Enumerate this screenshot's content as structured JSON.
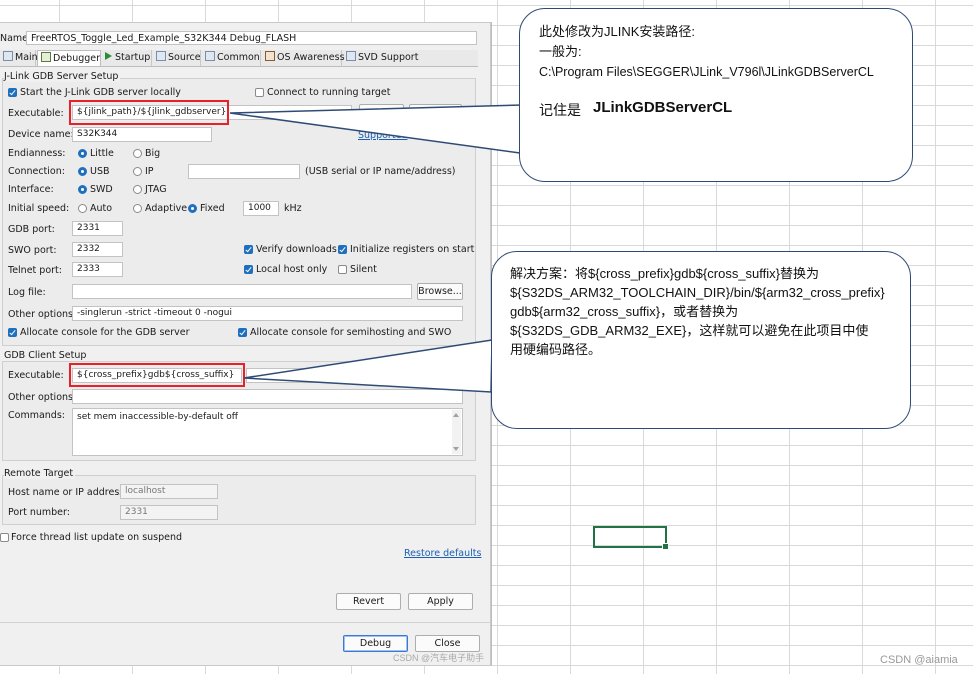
{
  "dialog": {
    "name_label": "Name:",
    "name_value": "FreeRTOS_Toggle_Led_Example_S32K344 Debug_FLASH",
    "tabs": [
      {
        "label": "Main",
        "icon": "main-icon"
      },
      {
        "label": "Debugger",
        "icon": "debugger-icon"
      },
      {
        "label": "Startup",
        "icon": "startup-icon"
      },
      {
        "label": "Source",
        "icon": "source-icon"
      },
      {
        "label": "Common",
        "icon": "common-icon"
      },
      {
        "label": "OS Awareness",
        "icon": "os-awareness-icon"
      },
      {
        "label": "SVD Support",
        "icon": "svd-support-icon"
      }
    ],
    "server": {
      "group_title": "J-Link GDB Server Setup",
      "start_locally_label": "Start the J-Link GDB server locally",
      "connect_running_label": "Connect to running target",
      "executable_label": "Executable:",
      "executable_value": "${jlink_path}/${jlink_gdbserver}",
      "device_name_label": "Device name:",
      "device_name_value": "S32K344",
      "supported_link": "Supported",
      "endianness_label": "Endianness:",
      "endianness_little": "Little",
      "endianness_big": "Big",
      "connection_label": "Connection:",
      "connection_usb": "USB",
      "connection_ip": "IP",
      "connection_hint": "(USB serial or IP name/address)",
      "interface_label": "Interface:",
      "interface_swd": "SWD",
      "interface_jtag": "JTAG",
      "speed_label": "Initial speed:",
      "speed_auto": "Auto",
      "speed_adaptive": "Adaptive",
      "speed_fixed": "Fixed",
      "speed_value": "1000",
      "speed_unit": "kHz",
      "gdb_port_label": "GDB port:",
      "gdb_port_value": "2331",
      "swo_port_label": "SWO port:",
      "swo_port_value": "2332",
      "telnet_port_label": "Telnet port:",
      "telnet_port_value": "2333",
      "verify_downloads_label": "Verify downloads",
      "init_registers_label": "Initialize registers on start",
      "local_host_only_label": "Local host only",
      "silent_label": "Silent",
      "log_file_label": "Log file:",
      "log_file_value": "",
      "browse_label": "Browse...",
      "other_options_label": "Other options:",
      "other_options_value": "-singlerun -strict -timeout 0 -nogui",
      "allocate_gdb_label": "Allocate console for the GDB server",
      "allocate_semihost_label": "Allocate console for semihosting and SWO"
    },
    "client": {
      "group_title": "GDB Client Setup",
      "executable_label": "Executable:",
      "executable_value": "${cross_prefix}gdb${cross_suffix}",
      "other_options_label": "Other options:",
      "other_options_value": "",
      "commands_label": "Commands:",
      "commands_value": "set mem inaccessible-by-default off"
    },
    "remote": {
      "group_title": "Remote Target",
      "host_label": "Host name or IP address:",
      "host_value": "localhost",
      "port_label": "Port number:",
      "port_value": "2331"
    },
    "force_thread_label": "Force thread list update on suspend",
    "restore_defaults_label": "Restore defaults",
    "revert_label": "Revert",
    "apply_label": "Apply",
    "debug_label": "Debug",
    "close_label": "Close"
  },
  "callout1": {
    "line1": "此处修改为JLINK安装路径:",
    "line2": "一般为:",
    "line3": "C:\\Program Files\\SEGGER\\JLink_V796l\\JLinkGDBServerCL",
    "line4_prefix": "记住是",
    "line4_bold": "JLinkGDBServerCL"
  },
  "callout2": {
    "line1": "解决方案：将${cross_prefix}gdb${cross_suffix}替换为",
    "line2": "${S32DS_ARM32_TOOLCHAIN_DIR}/bin/${arm32_cross_prefix}",
    "line3": "gdb${arm32_cross_suffix}，或者替换为",
    "line4": "${S32DS_GDB_ARM32_EXE}，这样就可以避免在此项目中使",
    "line5": "用硬编码路径。"
  },
  "watermarks": {
    "dialog_wm": "CSDN @汽车电子助手",
    "page_wm": "CSDN @aiamia"
  },
  "colors": {
    "highlight_red": "#e8202a",
    "callout_border": "#2f4b75",
    "checkbox_blue": "#1f6fbf",
    "excel_selection": "#217346"
  }
}
